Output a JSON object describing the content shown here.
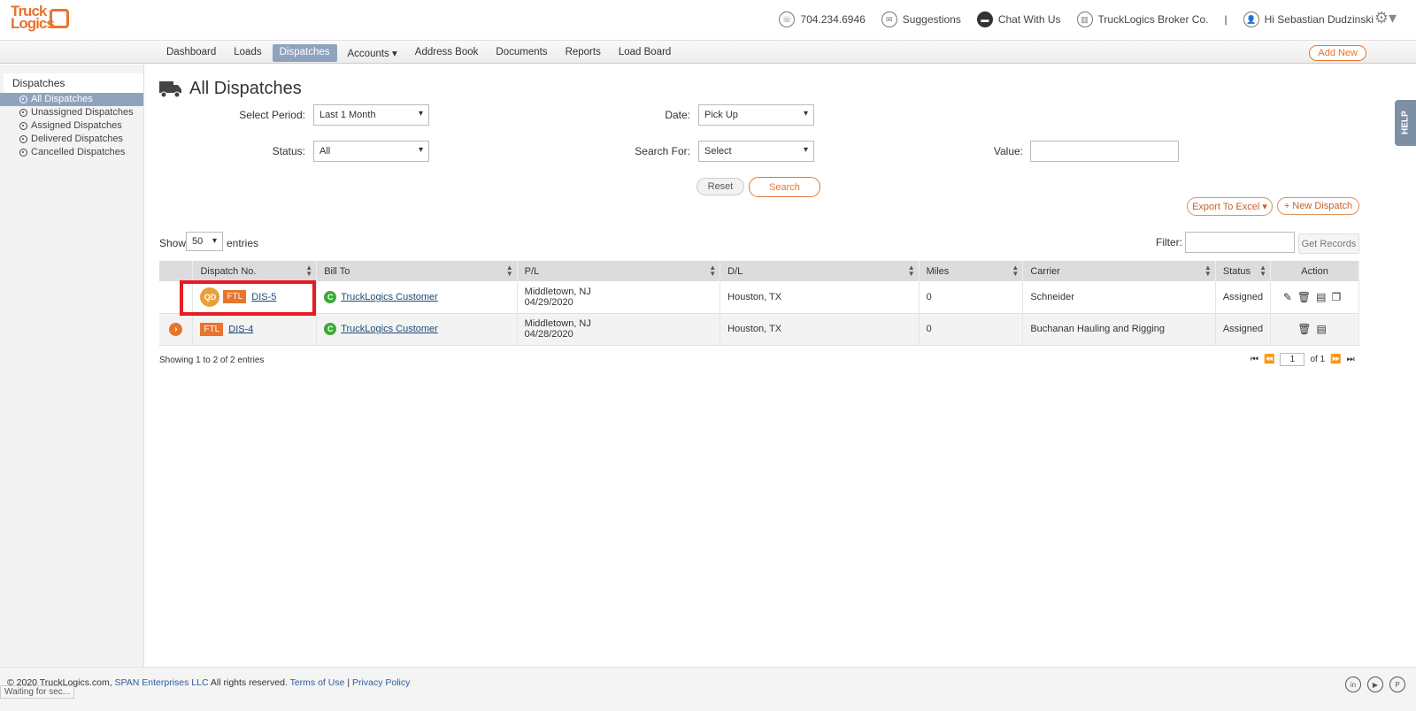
{
  "logo": "TruckLogics",
  "top": {
    "phone": "704.234.6946",
    "suggestions": "Suggestions",
    "chat": "Chat With Us",
    "company": "TruckLogics Broker Co.",
    "sep": "|",
    "greeting": "Hi Sebastian Dudzinski"
  },
  "nav": {
    "items": [
      "Dashboard",
      "Loads",
      "Dispatches",
      "Accounts ▾",
      "Address Book",
      "Documents",
      "Reports",
      "Load Board"
    ],
    "add_new": "Add New"
  },
  "sidebar": {
    "head": "Dispatches",
    "items": [
      "All Dispatches",
      "Unassigned Dispatches",
      "Assigned Dispatches",
      "Delivered Dispatches",
      "Cancelled Dispatches"
    ]
  },
  "page": {
    "title": "All Dispatches"
  },
  "filters": {
    "period_label": "Select Period:",
    "period_value": "Last 1 Month",
    "date_label": "Date:",
    "date_value": "Pick Up",
    "status_label": "Status:",
    "status_value": "All",
    "search_for_label": "Search For:",
    "search_for_value": "Select",
    "value_label": "Value:",
    "value": "",
    "reset": "Reset",
    "search": "Search"
  },
  "actions": {
    "export": "Export To Excel ▾",
    "new_dispatch": "+ New Dispatch"
  },
  "list": {
    "show": "Show",
    "entries_value": "50",
    "entries": "entries",
    "filter_label": "Filter:",
    "filter_value": "",
    "get_records": "Get Records",
    "info": "Showing 1 to 2 of 2 entries",
    "page": "1",
    "of": "of 1"
  },
  "help": "HELP",
  "table": {
    "headers": [
      "Dispatch No.",
      "Bill To",
      "P/L",
      "D/L",
      "Miles",
      "Carrier",
      "Status",
      "Action"
    ],
    "rows": [
      {
        "qd": "QD",
        "type": "FTL",
        "no": "DIS-5",
        "bill_to": "TruckLogics Customer",
        "pl_city": "Middletown, NJ",
        "pl_date": "04/29/2020",
        "dl": "Houston, TX",
        "miles": "0",
        "carrier": "Schneider",
        "status": "Assigned"
      },
      {
        "type": "FTL",
        "no": "DIS-4",
        "bill_to": "TruckLogics Customer",
        "pl_city": "Middletown, NJ",
        "pl_date": "04/28/2020",
        "dl": "Houston, TX",
        "miles": "0",
        "carrier": "Buchanan Hauling and Rigging",
        "status": "Assigned"
      }
    ]
  },
  "footer": {
    "copy": "© 2020 TruckLogics.com,",
    "span": "SPAN Enterprises LLC",
    "rights": "All rights reserved.",
    "terms": "Terms of Use",
    "sep": "|",
    "privacy": "Privacy Policy",
    "status_bar": "Waiting for sec..."
  },
  "colors": {
    "brand": "#e8742f",
    "active": "#8fa3bf",
    "highlight": "#e51c23"
  }
}
